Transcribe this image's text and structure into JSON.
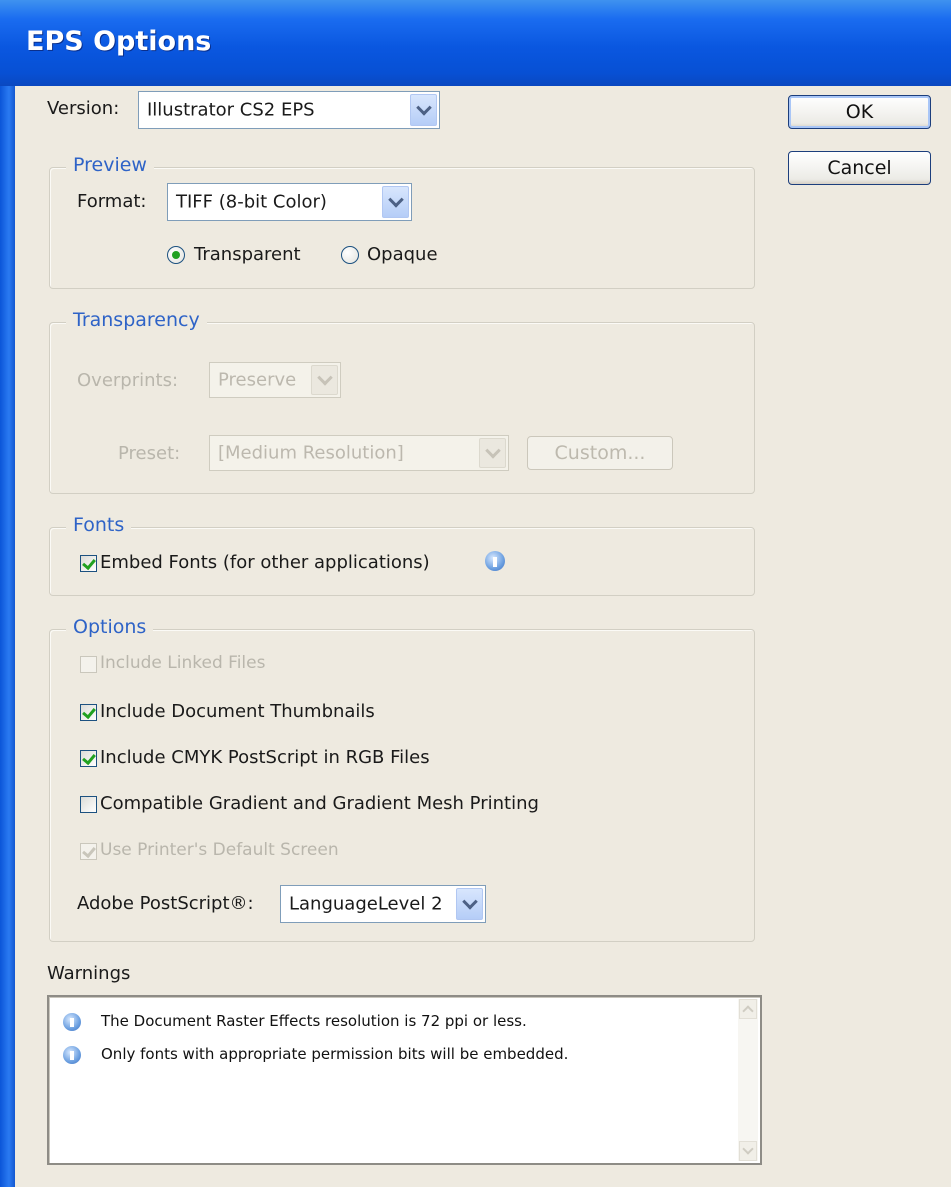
{
  "dialog": {
    "title": "EPS Options"
  },
  "version": {
    "label": "Version:",
    "value": "Illustrator CS2 EPS"
  },
  "buttons": {
    "ok": "OK",
    "cancel": "Cancel"
  },
  "preview": {
    "legend": "Preview",
    "format_label": "Format:",
    "format_value": "TIFF (8-bit Color)",
    "radio_transparent": "Transparent",
    "radio_opaque": "Opaque",
    "selected": "Transparent"
  },
  "transparency": {
    "legend": "Transparency",
    "overprints_label": "Overprints:",
    "overprints_value": "Preserve",
    "preset_label": "Preset:",
    "preset_value": "[Medium Resolution]",
    "custom_button": "Custom..."
  },
  "fonts": {
    "legend": "Fonts",
    "embed_label": "Embed Fonts (for other applications)",
    "embed_checked": true
  },
  "options": {
    "legend": "Options",
    "include_linked": {
      "label": "Include Linked Files",
      "checked": false,
      "enabled": false
    },
    "include_thumbnails": {
      "label": "Include Document Thumbnails",
      "checked": true,
      "enabled": true
    },
    "include_cmyk": {
      "label": "Include CMYK PostScript in RGB Files",
      "checked": true,
      "enabled": true
    },
    "compatible_gradient": {
      "label": "Compatible Gradient and Gradient Mesh Printing",
      "checked": false,
      "enabled": true
    },
    "printer_default_screen": {
      "label": "Use Printer's Default Screen",
      "checked": true,
      "enabled": false
    },
    "postscript_label": "Adobe PostScript®:",
    "postscript_value": "LanguageLevel 2"
  },
  "warnings": {
    "label": "Warnings",
    "items": [
      "The Document Raster Effects resolution is 72 ppi or less.",
      "Only fonts with appropriate permission bits will be embedded."
    ]
  }
}
